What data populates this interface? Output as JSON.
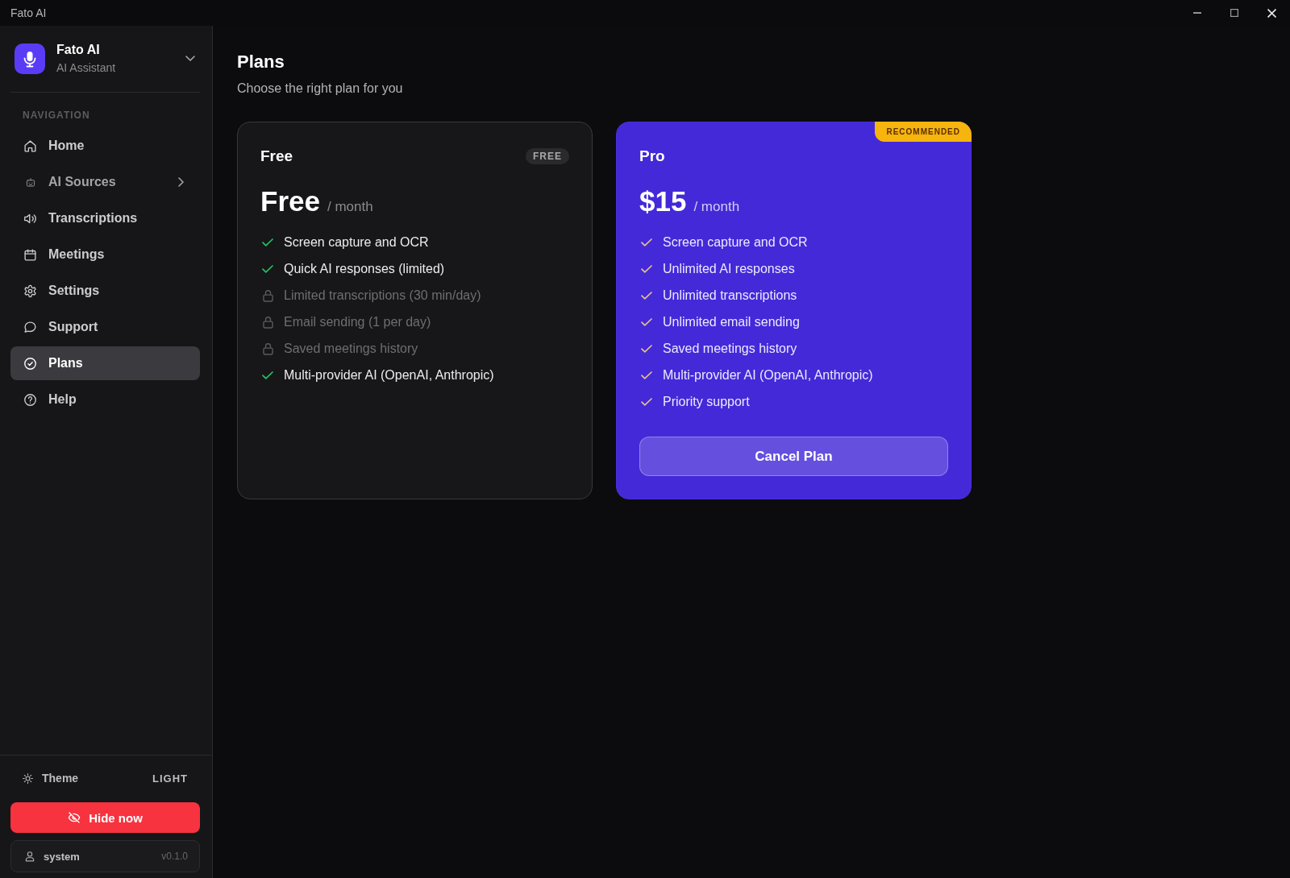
{
  "window": {
    "title": "Fato AI"
  },
  "sidebar": {
    "brand": {
      "name": "Fato AI",
      "subtitle": "AI Assistant"
    },
    "section_label": "NAVIGATION",
    "nav": [
      {
        "label": "Home",
        "kind": "link",
        "selected": false
      },
      {
        "label": "AI Sources",
        "kind": "group",
        "expanded": false,
        "selected": false
      },
      {
        "label": "Transcriptions",
        "kind": "link",
        "selected": false
      },
      {
        "label": "Meetings",
        "kind": "link",
        "selected": false
      },
      {
        "label": "Settings",
        "kind": "link",
        "selected": false
      },
      {
        "label": "Support",
        "kind": "link",
        "selected": false
      },
      {
        "label": "Plans",
        "kind": "link",
        "selected": true
      },
      {
        "label": "Help",
        "kind": "link",
        "selected": false
      }
    ],
    "theme": {
      "label": "Theme",
      "value": "LIGHT"
    },
    "hide_button": "Hide now",
    "user": {
      "name": "system",
      "version": "v0.1.0"
    }
  },
  "page": {
    "title": "Plans",
    "subtitle": "Choose the right plan for you"
  },
  "plans": [
    {
      "name": "Free",
      "tag": "FREE",
      "price": "Free",
      "period": "/ month",
      "featured": false,
      "features": [
        {
          "text": "Screen capture and OCR",
          "included": true
        },
        {
          "text": "Quick AI responses (limited)",
          "included": true
        },
        {
          "text": "Limited transcriptions (30 min/day)",
          "included": false
        },
        {
          "text": "Email sending (1 per day)",
          "included": false
        },
        {
          "text": "Saved meetings history",
          "included": false
        },
        {
          "text": "Multi-provider AI (OpenAI, Anthropic)",
          "included": true
        }
      ]
    },
    {
      "name": "Pro",
      "ribbon": "RECOMMENDED",
      "price": "$15",
      "period": "/ month",
      "featured": true,
      "features": [
        {
          "text": "Screen capture and OCR",
          "included": true
        },
        {
          "text": "Unlimited AI responses",
          "included": true
        },
        {
          "text": "Unlimited transcriptions",
          "included": true
        },
        {
          "text": "Unlimited email sending",
          "included": true
        },
        {
          "text": "Saved meetings history",
          "included": true
        },
        {
          "text": "Multi-provider AI (OpenAI, Anthropic)",
          "included": true
        },
        {
          "text": "Priority support",
          "included": true
        }
      ],
      "button": "Cancel Plan"
    }
  ]
}
